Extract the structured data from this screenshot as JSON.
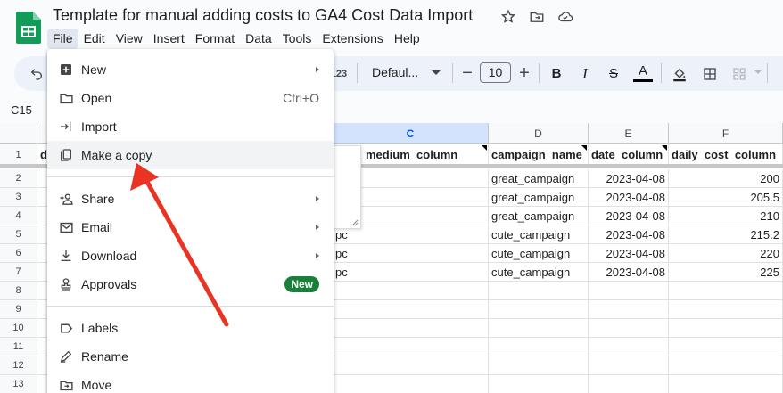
{
  "doc": {
    "title": "Template for manual adding costs to GA4 Cost Data Import"
  },
  "menubar": [
    {
      "label": "File",
      "active": true
    },
    {
      "label": "Edit"
    },
    {
      "label": "View"
    },
    {
      "label": "Insert"
    },
    {
      "label": "Format"
    },
    {
      "label": "Data"
    },
    {
      "label": "Tools"
    },
    {
      "label": "Extensions"
    },
    {
      "label": "Help"
    }
  ],
  "toolbar": {
    "number_format_label": "123",
    "font_name": "Defaul...",
    "font_size": "10"
  },
  "namebox": "C15",
  "colors": {
    "accent": "#0b57d0",
    "new_badge": "#188038",
    "arrow": "#ea3323",
    "sheets_green": "#0f9d58"
  },
  "columns": [
    "C",
    "D",
    "E",
    "F"
  ],
  "rows": [
    "1",
    "2",
    "3",
    "4",
    "5",
    "6",
    "7",
    "8",
    "9",
    "10",
    "11",
    "12",
    "13"
  ],
  "header_row": {
    "c": "aign_medium_column",
    "d": "campaign_name",
    "e": "date_column",
    "f": "daily_cost_column",
    "a_partial": "d"
  },
  "data_rows": [
    {
      "c": "",
      "d": "great_campaign",
      "e": "2023-04-08",
      "f": "200"
    },
    {
      "c": "",
      "d": "great_campaign",
      "e": "2023-04-08",
      "f": "205.5"
    },
    {
      "c": "",
      "d": "great_campaign",
      "e": "2023-04-08",
      "f": "210"
    },
    {
      "c": "pc",
      "d": "cute_campaign",
      "e": "2023-04-08",
      "f": "215.2"
    },
    {
      "c": "pc",
      "d": "cute_campaign",
      "e": "2023-04-08",
      "f": "220"
    },
    {
      "c": "pc",
      "d": "cute_campaign",
      "e": "2023-04-08",
      "f": "225"
    }
  ],
  "file_menu": {
    "new": {
      "label": "New",
      "icon": "plus-box-icon"
    },
    "open": {
      "label": "Open",
      "shortcut": "Ctrl+O",
      "icon": "folder-icon"
    },
    "import": {
      "label": "Import",
      "icon": "import-arrow-icon"
    },
    "make_copy": {
      "label": "Make a copy",
      "icon": "copy-icon"
    },
    "share": {
      "label": "Share",
      "icon": "person-add-icon"
    },
    "email": {
      "label": "Email",
      "icon": "mail-icon"
    },
    "download": {
      "label": "Download",
      "icon": "download-icon"
    },
    "approvals": {
      "label": "Approvals",
      "badge": "New",
      "icon": "approval-stamp-icon"
    },
    "labels": {
      "label": "Labels",
      "icon": "label-icon"
    },
    "rename": {
      "label": "Rename",
      "icon": "rename-pen-icon"
    },
    "move": {
      "label": "Move",
      "icon": "move-folder-icon"
    }
  }
}
